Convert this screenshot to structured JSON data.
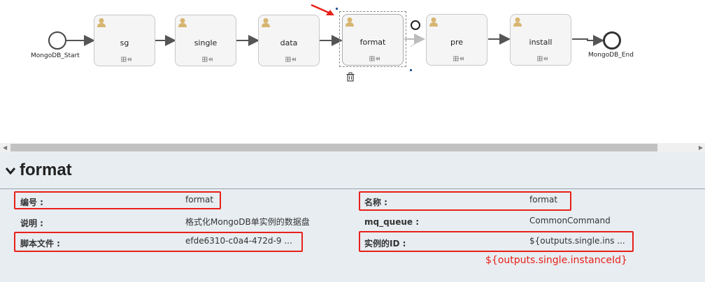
{
  "diagram": {
    "start_label": "MongoDB_Start",
    "end_label": "MongoDB_End",
    "tasks": [
      "sg",
      "single",
      "data",
      "format",
      "pre",
      "install"
    ],
    "selected_task": "format"
  },
  "panel": {
    "title": "format",
    "fields": {
      "id_label": "编号 :",
      "id_value": "format",
      "name_label": "名称 :",
      "name_value": "format",
      "desc_label": "说明 :",
      "desc_value": "格式化MongoDB单实例的数据盘",
      "mq_label": "mq_queue :",
      "mq_value": "CommonCommand",
      "script_label": "脚本文件 :",
      "script_value": "efde6310-c0a4-472d-9 ...",
      "instance_label": "实例的ID :",
      "instance_value": "${outputs.single.ins ..."
    },
    "annotation": "${outputs.single.instanceId}"
  },
  "colors": {
    "highlight": "#e8201a",
    "panel_bg": "#e8edf1"
  }
}
